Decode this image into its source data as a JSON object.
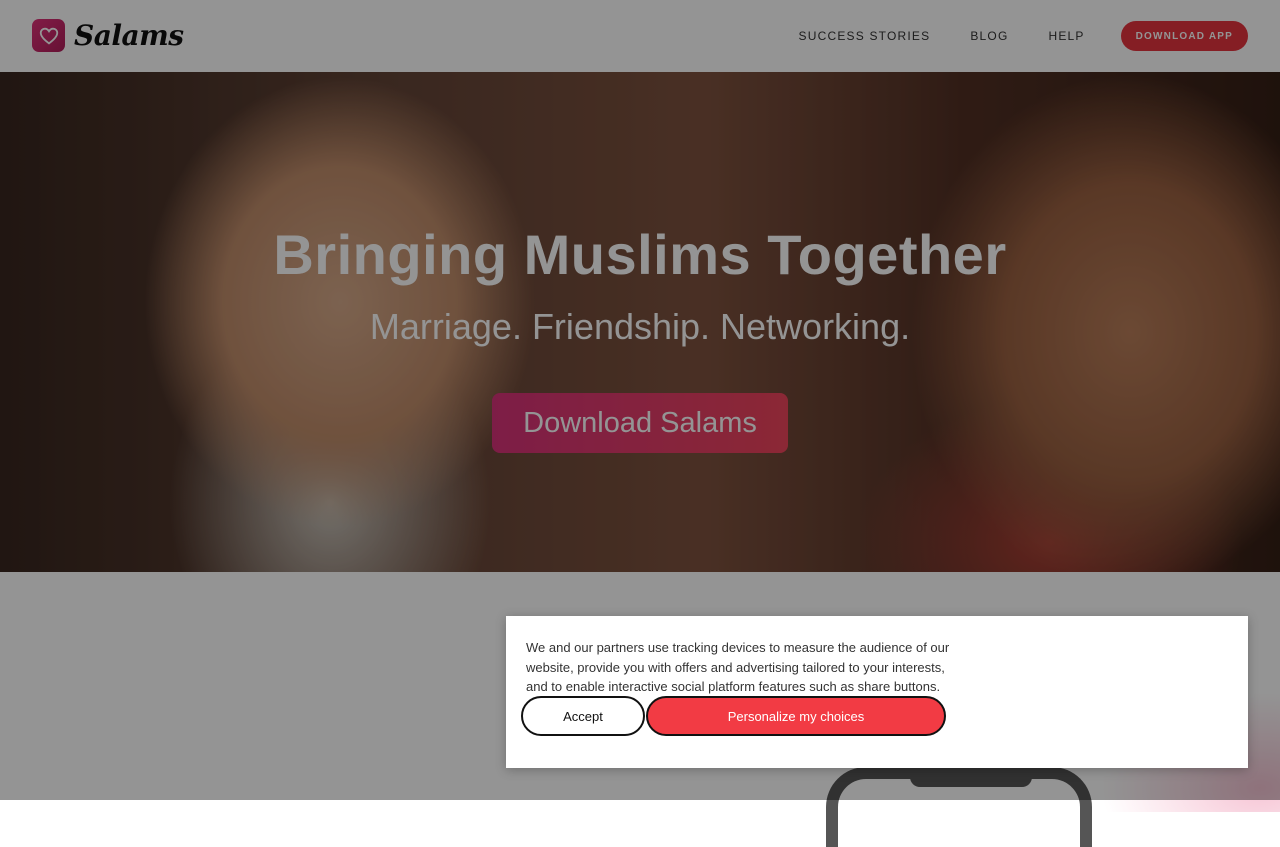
{
  "brand": {
    "name": "Salams",
    "accent": "#e5343f",
    "logo_icon": "heart-icon"
  },
  "nav": {
    "links": [
      "SUCCESS STORIES",
      "BLOG",
      "HELP"
    ],
    "cta": "DOWNLOAD APP"
  },
  "hero": {
    "title": "Bringing Muslims Together",
    "subtitle": "Marriage. Friendship. Networking.",
    "cta": "Download Salams"
  },
  "cookie_banner": {
    "text": "We and our partners use tracking devices to measure the audience of our website, provide you with offers and advertising tailored to your interests, and to enable interactive social platform features such as share buttons.",
    "accept": "Accept",
    "personalize": "Personalize my choices",
    "personalize_color": "#f23b44"
  }
}
